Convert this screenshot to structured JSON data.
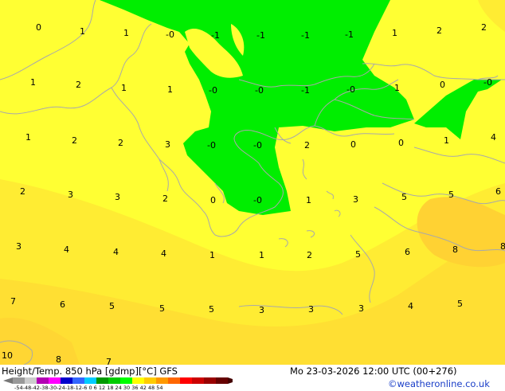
{
  "footer": {
    "product": "Height/Temp. 850 hPa [gdmp][°C] GFS",
    "valid_time": "Mo 23-03-2026 12:00 UTC (00+276)",
    "credit": "©weatheronline.co.uk",
    "scale_ticks": "-54-48-42-38-30-24-18-12-6 0 6 12 18 24 30 36 42 48 54"
  },
  "colors": {
    "yellow": "#ffff33",
    "warm_yellow": "#ffe033",
    "orange_yellow": "#ffcc33",
    "green": "#00ee00",
    "coast": "#aaaaaa",
    "scale": [
      "#999999",
      "#cccccc",
      "#b300b3",
      "#ff00ff",
      "#0000cc",
      "#3366ff",
      "#00ccff",
      "#009900",
      "#00cc00",
      "#00ff00",
      "#ffff00",
      "#ffcc00",
      "#ff9900",
      "#ff6600",
      "#ff0000",
      "#cc0000",
      "#990000",
      "#660000"
    ]
  },
  "temperature_labels": [
    "0",
    "1",
    "1",
    "-0",
    "-1",
    "-1",
    "-1",
    "-1",
    "1",
    "2",
    "2",
    "1",
    "2",
    "1",
    "1",
    "-0",
    "-0",
    "-1",
    "-0",
    "1",
    "0",
    "-0",
    "1",
    "2",
    "2",
    "3",
    "-0",
    "-0",
    "2",
    "0",
    "0",
    "1",
    "4",
    "2",
    "3",
    "3",
    "2",
    "0",
    "-0",
    "1",
    "3",
    "5",
    "5",
    "6",
    "3",
    "4",
    "4",
    "4",
    "1",
    "1",
    "2",
    "5",
    "6",
    "8",
    "8",
    "7",
    "6",
    "5",
    "5",
    "5",
    "3",
    "3",
    "3",
    "4",
    "5",
    "10",
    "8",
    "7"
  ]
}
